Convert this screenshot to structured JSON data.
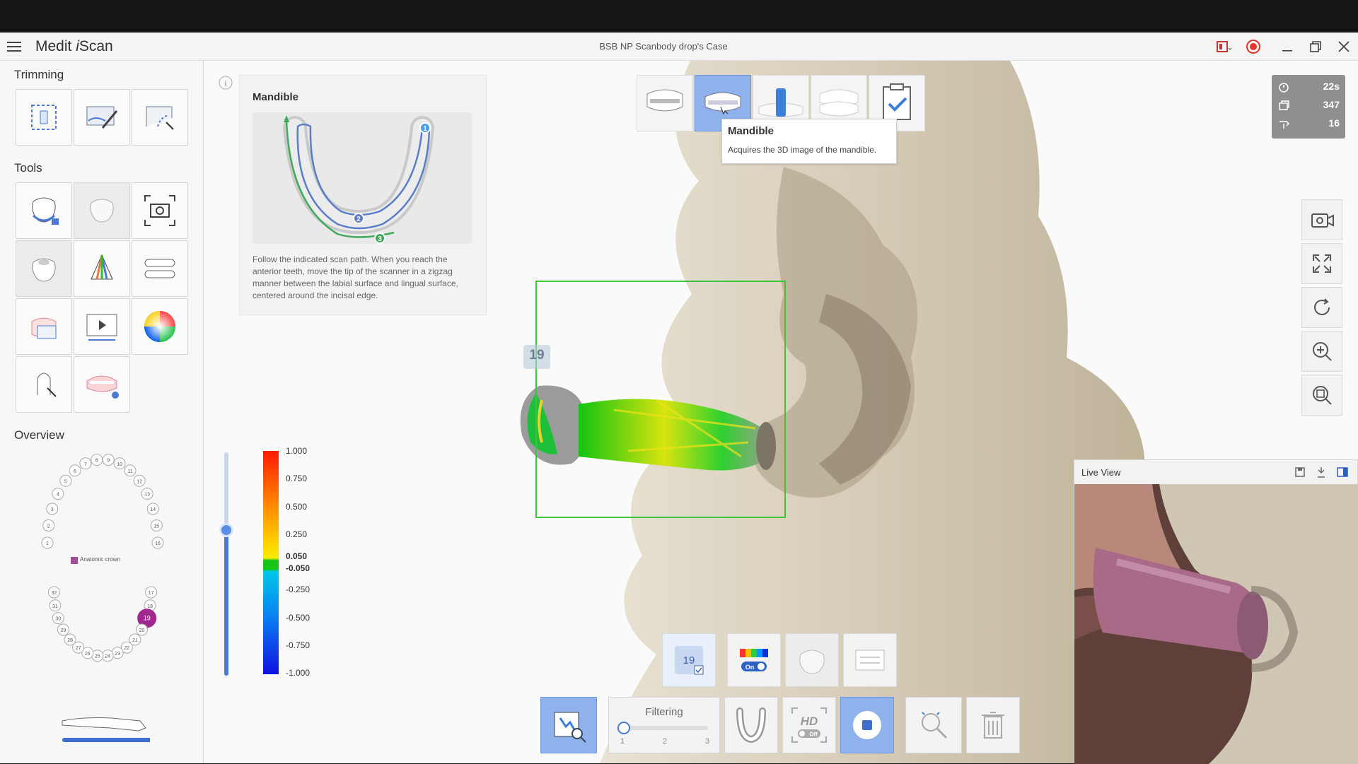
{
  "app": {
    "name_prefix": "Medit ",
    "name_italic": "i",
    "name_suffix": "Scan",
    "case_title": "BSB NP Scanbody drop's Case"
  },
  "sidebar": {
    "trimming_title": "Trimming",
    "tools_title": "Tools",
    "overview_title": "Overview",
    "overview_legend": "Anatomic crown",
    "tooth_numbers": [
      "1",
      "2",
      "3",
      "4",
      "5",
      "6",
      "7",
      "8",
      "9",
      "10",
      "11",
      "12",
      "13",
      "14",
      "15",
      "16",
      "17",
      "18",
      "19",
      "20",
      "21",
      "22",
      "23",
      "24",
      "25",
      "26",
      "27",
      "28",
      "29",
      "30",
      "31",
      "32"
    ]
  },
  "guide": {
    "title": "Mandible",
    "info_icon": "i",
    "text": "Follow the indicated scan path. When you reach the anterior teeth, move the tip of the scanner in a zigzag manner between the labial surface and lingual surface, centered around the incisal edge.",
    "step1": "1",
    "step2": "2",
    "step3": "3"
  },
  "tooltip": {
    "title": "Mandible",
    "description": "Acquires the 3D image of the mandible."
  },
  "stats": {
    "time": "22s",
    "count": "347",
    "third": "16"
  },
  "scan_label": "19",
  "colorbar": {
    "labels": [
      "1.000",
      "0.750",
      "0.500",
      "0.250",
      "0.050",
      "-0.050",
      "-0.250",
      "-0.500",
      "-0.750",
      "-1.000"
    ]
  },
  "bottom": {
    "tooth_badge": "19",
    "color_toggle": "On",
    "filtering_label": "Filtering",
    "filter_ticks": [
      "1",
      "2",
      "3"
    ],
    "hd_label": "HD",
    "hd_toggle": "Off"
  },
  "liveview": {
    "title": "Live View"
  },
  "colors": {
    "accent": "#8fb2ec",
    "active_blue": "#4a7ad6",
    "record_red": "#e8332a",
    "roi_green": "#3ec53e"
  }
}
